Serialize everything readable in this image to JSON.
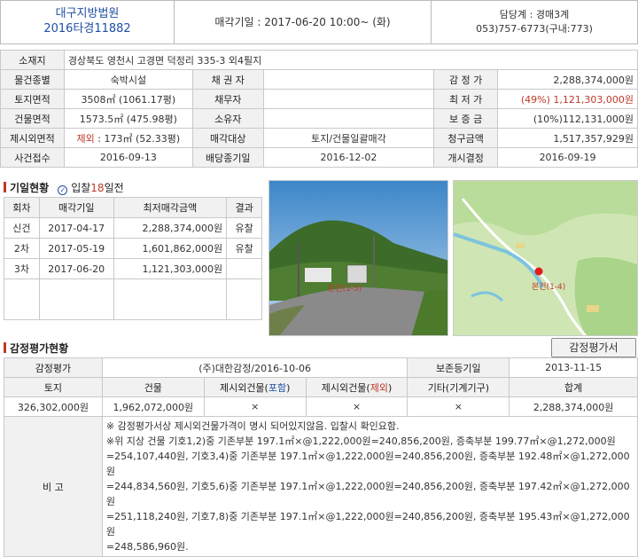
{
  "header": {
    "court": "대구지방법원",
    "case_no": "2016타경11882",
    "auction_date": "매각기일 : 2017-06-20   10:00~ (화)",
    "team": "담당계 : 경매3계",
    "phone": "053)757-6773(구내:773)"
  },
  "info": {
    "address_label": "소재지",
    "address_value": "경상북도 영천시 고경면 덕정리 335-3 외4필지",
    "r1": [
      "물건종별",
      "숙박시설",
      "채 권 자",
      "",
      "감 정 가",
      "2,288,374,000원"
    ],
    "r2": [
      "토지면적",
      "3508㎡ (1061.17평)",
      "채무자",
      "",
      "최 저 가",
      "(49%) 1,121,303,000원"
    ],
    "r3": [
      "건물면적",
      "1573.5㎡ (475.98평)",
      "소유자",
      "",
      "보 증 금",
      "(10%)112,131,000원"
    ],
    "r4_label": "제시외면적",
    "r4_excl": "제외",
    "r4_value": " : 173㎡ (52.33평)",
    "r4": [
      "매각대상",
      "토지/건물일괄매각",
      "청구금액",
      "1,517,357,929원"
    ],
    "r5": [
      "사건접수",
      "2016-09-13",
      "배당종기일",
      "2016-12-02",
      "개시결정",
      "2016-09-19"
    ]
  },
  "schedule_section": {
    "title": "기일현황",
    "dday_prefix": "입찰",
    "dday_num": "18",
    "dday_suffix": "일전"
  },
  "schedule": {
    "headers": [
      "회차",
      "매각기일",
      "최저매각금액",
      "결과"
    ],
    "rows": [
      [
        "신건",
        "2017-04-17",
        "2,288,374,000원",
        "유찰"
      ],
      [
        "2차",
        "2017-05-19",
        "1,601,862,000원",
        "유찰"
      ],
      [
        "3차",
        "2017-06-20",
        "1,121,303,000원",
        ""
      ]
    ]
  },
  "photo_label": "본건(1-5)",
  "map_label": "본건(1-4)",
  "appraisal_section": {
    "title": "감정평가현황",
    "button": "감정평가서"
  },
  "appraisal": {
    "label_appraisal": "감정평가",
    "appraiser": "(주)대한감정/2016-10-06",
    "label_retention": "보존등기일",
    "retention_date": "2013-11-15",
    "h_land": "토지",
    "h_building": "건물",
    "h_incl_pre": "제시외건물(",
    "h_incl_word": "포함",
    "h_excl_pre": "제시외건물(",
    "h_excl_word": "제외",
    "h_close": ")",
    "h_other": "기타(기계기구)",
    "h_total": "합계",
    "v_land": "326,302,000원",
    "v_building": "1,962,072,000원",
    "v_incl": "×",
    "v_excl": "×",
    "v_other": "×",
    "v_total": "2,288,374,000원",
    "remarks_label": "비 고",
    "remarks": [
      "※ 감정평가서상 제시외건물가격이 명시 되어있지않음. 입찰시 확인요함.",
      "※위 지상 건물 기호1,2)중 기존부분 197.1㎡×@1,222,000원=240,856,200원, 증축부분 199.77㎡×@1,272,000원",
      "=254,107,440원, 기호3,4)중 기존부분 197.1㎡×@1,222,000원=240,856,200원, 증축부분 192.48㎡×@1,272,000원",
      "=244,834,560원, 기호5,6)중 기존부분 197.1㎡×@1,222,000원=240,856,200원, 증축부분 197.42㎡×@1,272,000원",
      "=251,118,240원, 기호7,8)중 기존부분 197.1㎡×@1,222,000원=240,856,200원, 증축부분 195.43㎡×@1,272,000원",
      "=248,586,960원."
    ]
  }
}
